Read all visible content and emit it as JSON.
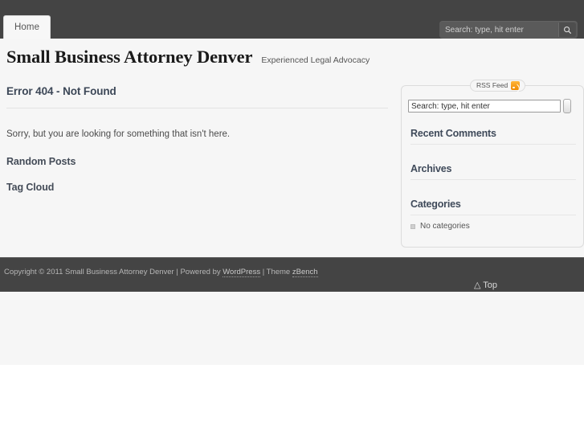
{
  "nav": {
    "tabs": [
      {
        "label": "Home"
      }
    ]
  },
  "header_search": {
    "placeholder": "Search: type, hit enter",
    "value": "",
    "button_icon": "search-icon"
  },
  "branding": {
    "site_title": "Small Business Attorney Denver",
    "site_description": "Experienced Legal Advocacy"
  },
  "content": {
    "entry_title": "Error 404 - Not Found",
    "entry_body": "Sorry, but you are looking for something that isn't here.",
    "sections": [
      {
        "title": "Random Posts"
      },
      {
        "title": "Tag Cloud"
      }
    ]
  },
  "sidebar": {
    "rss": {
      "label": "RSS Feed",
      "icon": "rss-icon"
    },
    "search": {
      "placeholder": "Search: type, hit enter",
      "value": "",
      "button_label": ""
    },
    "widgets": [
      {
        "title": "Recent Comments",
        "items": []
      },
      {
        "title": "Archives",
        "items": []
      },
      {
        "title": "Categories",
        "items": [
          "No categories"
        ]
      }
    ]
  },
  "footer": {
    "copyright_prefix": "Copyright © 2011 Small Business Attorney Denver  | Powered by ",
    "wordpress_link": "WordPress",
    "theme_prefix": "  | Theme ",
    "theme_link": "zBench",
    "top_link": "△ Top"
  },
  "colors": {
    "nav_bar": "#444444",
    "page_bg": "#f6f6f6",
    "heading": "#3c4757",
    "rss_orange": "#f08a00"
  }
}
